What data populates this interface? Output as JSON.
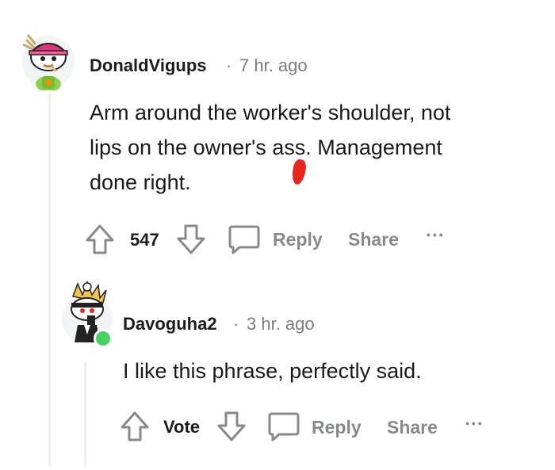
{
  "comments": [
    {
      "username": "DonaldVigups",
      "separator": "·",
      "time": "7 hr. ago",
      "body_lines": [
        "Arm around the worker's shoulder, not",
        "lips on the owner's as",
        "s. Management",
        "done right."
      ],
      "score": "547",
      "reply_label": "Reply",
      "share_label": "Share",
      "more_label": "•••",
      "icons": [
        "upvote-icon",
        "downvote-icon",
        "comment-icon",
        "more-icon"
      ]
    },
    {
      "username": "Davoguha2",
      "separator": "·",
      "time": "3 hr. ago",
      "body": "I like this phrase, perfectly said.",
      "score": "Vote",
      "reply_label": "Reply",
      "share_label": "Share",
      "more_label": "•••",
      "online_color": "#46d160"
    }
  ],
  "colors": {
    "text": "#1a1a1b",
    "meta": "#7c7c7c",
    "action": "#878a8c",
    "thread_line": "#edeff1",
    "censor": "#e8261b"
  }
}
